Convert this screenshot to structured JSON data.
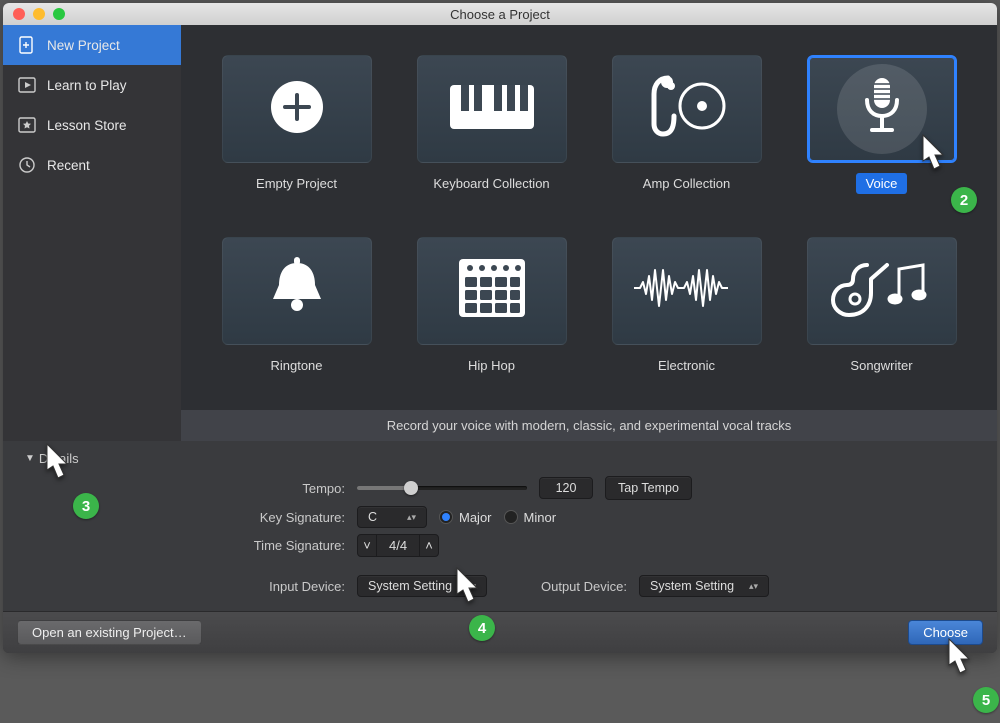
{
  "window_title": "Choose a Project",
  "sidebar": {
    "items": [
      {
        "icon": "plus-doc-icon",
        "label": "New Project",
        "selected": true
      },
      {
        "icon": "play-note-icon",
        "label": "Learn to Play",
        "selected": false
      },
      {
        "icon": "star-icon",
        "label": "Lesson Store",
        "selected": false
      },
      {
        "icon": "clock-icon",
        "label": "Recent",
        "selected": false
      }
    ]
  },
  "templates": [
    {
      "icon": "plus-circle-icon",
      "label": "Empty Project"
    },
    {
      "icon": "keyboard-icon",
      "label": "Keyboard Collection"
    },
    {
      "icon": "amp-icon",
      "label": "Amp Collection"
    },
    {
      "icon": "mic-icon",
      "label": "Voice",
      "selected": true
    },
    {
      "icon": "bell-icon",
      "label": "Ringtone"
    },
    {
      "icon": "drumpad-icon",
      "label": "Hip Hop"
    },
    {
      "icon": "wave-icon",
      "label": "Electronic"
    },
    {
      "icon": "guitar-notes-icon",
      "label": "Songwriter"
    }
  ],
  "description": "Record your voice with modern, classic, and experimental vocal tracks",
  "details": {
    "heading": "Details",
    "tempo_label": "Tempo:",
    "tempo_value": "120",
    "tap_tempo": "Tap Tempo",
    "key_label": "Key Signature:",
    "key_value": "C",
    "major": "Major",
    "minor": "Minor",
    "time_label": "Time Signature:",
    "time_value": "4/4",
    "input_label": "Input Device:",
    "input_value": "System Setting",
    "output_label": "Output Device:",
    "output_value": "System Setting"
  },
  "footer": {
    "open": "Open an existing Project…",
    "choose": "Choose"
  },
  "annotations": {
    "n2": "2",
    "n3": "3",
    "n4": "4",
    "n5": "5"
  }
}
